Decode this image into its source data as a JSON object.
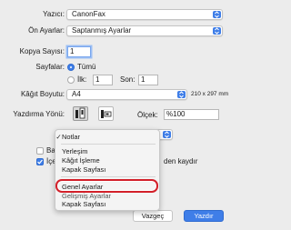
{
  "printer": {
    "label": "Yazıcı:",
    "value": "CanonFax"
  },
  "presets": {
    "label": "Ön Ayarlar:",
    "value": "Saptanmış Ayarlar"
  },
  "copies": {
    "label": "Kopya Sayısı:",
    "value": "1"
  },
  "pages": {
    "label": "Sayfalar:",
    "all_label": "Tümü",
    "from_label": "İlk:",
    "from_value": "1",
    "to_label": "Son:",
    "to_value": "1"
  },
  "paper_size": {
    "label": "Kâğıt Boyutu:",
    "value": "A4",
    "dimensions": "210 x 297 mm"
  },
  "orientation": {
    "label": "Yazdırma Yönü:"
  },
  "scale": {
    "label": "Ölçek:",
    "value": "%100"
  },
  "dropdown_menu": {
    "items": [
      {
        "label": "Notlar",
        "checked": true
      },
      {
        "label": "Yerleşim"
      },
      {
        "label": "Kâğıt İşleme"
      },
      {
        "label": "Kapak Sayfası"
      },
      {
        "label": "Genel Ayarlar",
        "highlighted": true
      },
      {
        "label": "Gelişmiş Ayarlar"
      },
      {
        "label": "Kapak Sayfası"
      }
    ],
    "check_glyph": "✓",
    "highlight_ring_color": "#d3202a"
  },
  "background_fragments": {
    "checkbox1_label": "Baş",
    "checkbox2_label": "İçer",
    "save_text": "den kaydır"
  },
  "buttons": {
    "cancel": "Vazgeç",
    "print": "Yazdır"
  },
  "colors": {
    "accent": "#3f7ee8",
    "highlight_ring": "#d3202a"
  }
}
